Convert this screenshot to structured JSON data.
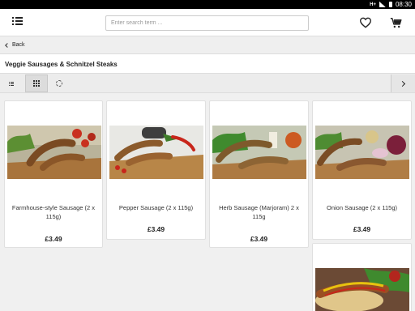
{
  "status_bar": {
    "network": "H+",
    "time": "08:30"
  },
  "header": {
    "search_placeholder": "Enter search term ..."
  },
  "back": {
    "label": "Back"
  },
  "category": {
    "title": "Veggie Sausages & Schnitzel Steaks"
  },
  "products": [
    {
      "name": "Farmhouse-style Sausage (2 x 115g)",
      "price": "£3.49"
    },
    {
      "name": "Pepper Sausage (2 x 115g)",
      "price": "£3.49"
    },
    {
      "name": "Herb Sausage (Marjoram) 2 x 115g",
      "price": "£3.49"
    },
    {
      "name": "Onion Sausage (2 x 115g)",
      "price": "£3.49"
    }
  ],
  "icons": {
    "menu": "menu-icon",
    "wishlist": "heart-icon",
    "cart": "cart-icon",
    "back": "chevron-left-icon",
    "list_view": "list-icon",
    "grid_view": "grid-icon",
    "refresh": "refresh-icon",
    "next": "chevron-right-icon"
  }
}
